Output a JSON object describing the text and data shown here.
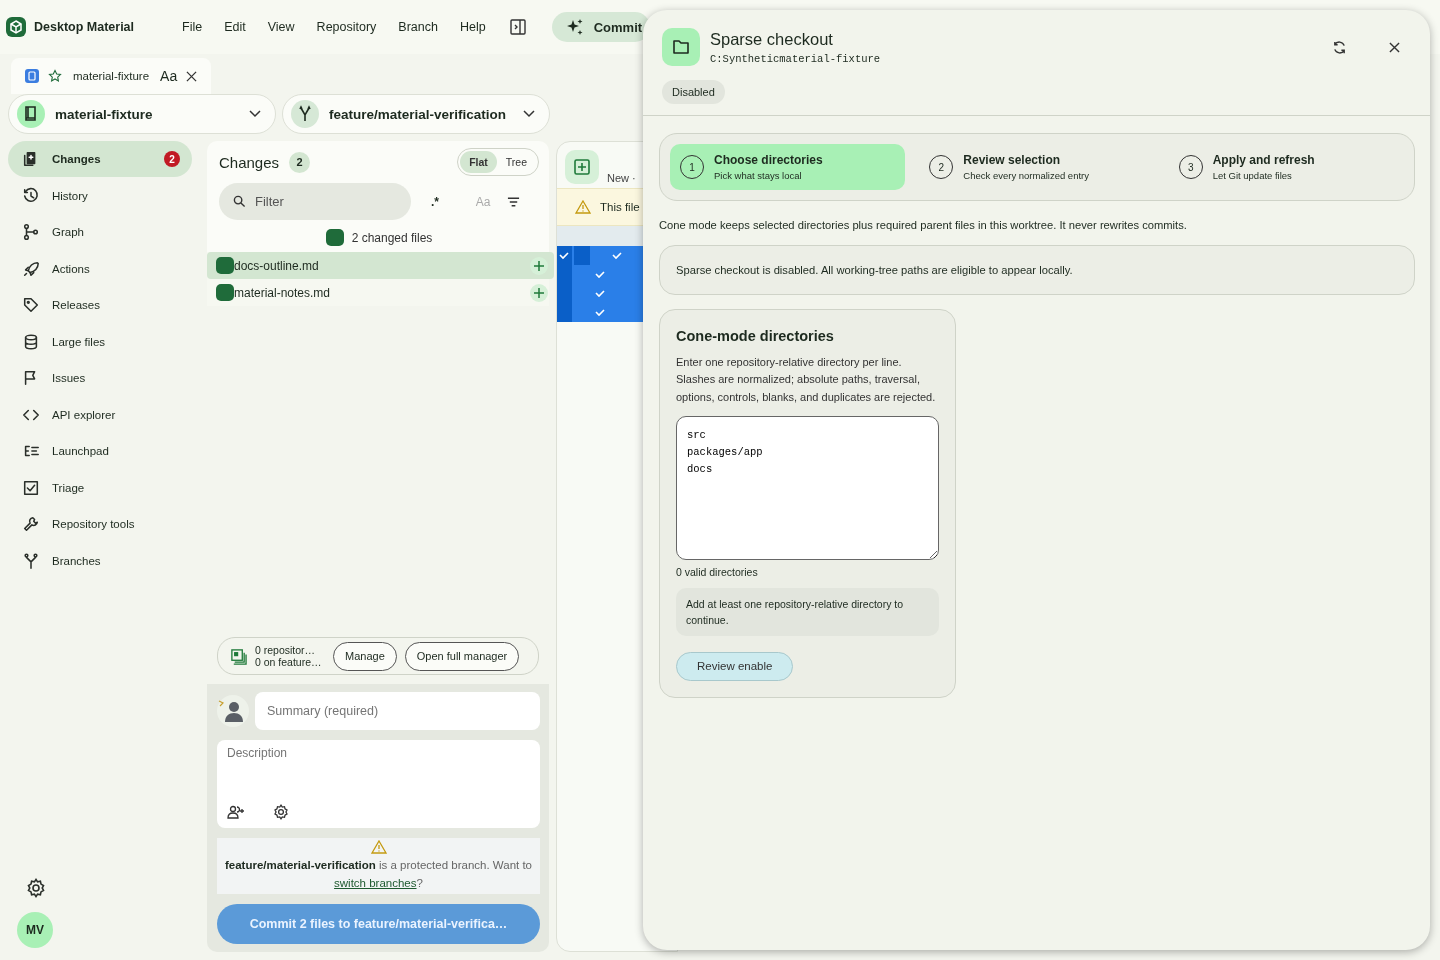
{
  "app": {
    "title": "Desktop Material",
    "menu": [
      "File",
      "Edit",
      "View",
      "Repository",
      "Branch",
      "Help"
    ],
    "commit_button": "Commit"
  },
  "repo_tab": {
    "name": "material-fixture",
    "font_toggle": "Aa"
  },
  "repository_selector": {
    "label": "material-fixture"
  },
  "branch_selector": {
    "label": "feature/material-verification"
  },
  "sidebar": {
    "items": [
      {
        "label": "Changes",
        "badge": "2",
        "selected": true
      },
      {
        "label": "History",
        "selected": false
      },
      {
        "label": "Graph",
        "selected": false
      },
      {
        "label": "Actions",
        "selected": false
      },
      {
        "label": "Releases",
        "selected": false
      },
      {
        "label": "Large files",
        "selected": false
      },
      {
        "label": "Issues",
        "selected": false
      },
      {
        "label": "API explorer",
        "selected": false
      },
      {
        "label": "Launchpad",
        "selected": false
      },
      {
        "label": "Triage",
        "selected": false
      },
      {
        "label": "Repository tools",
        "selected": false
      },
      {
        "label": "Branches",
        "selected": false
      }
    ],
    "user_initials": "MV"
  },
  "changes": {
    "title": "Changes",
    "count": "2",
    "view_modes": [
      {
        "label": "Flat",
        "selected": true
      },
      {
        "label": "Tree",
        "selected": false
      }
    ],
    "filter": {
      "placeholder": "Filter"
    },
    "regex_toggle": ".*",
    "case_toggle": "Aa",
    "summary": "2 changed files",
    "files": [
      {
        "name": "docs-outline.md",
        "selected": true
      },
      {
        "name": "material-notes.md",
        "selected": false
      }
    ]
  },
  "worktree_notice": {
    "line_1": "0 repositor…",
    "line_2": "0 on feature…",
    "buttons": [
      "Manage",
      "Open full manager"
    ]
  },
  "commit_form": {
    "summary": {
      "placeholder": "Summary (required)"
    },
    "description": {
      "placeholder": "Description"
    },
    "warning": "**feature/material-verification** is a protected branch. Want to",
    "warning_link": "switch branches",
    "warning_end": "?",
    "commit_button": "Commit 2 files to feature/material-verifica…"
  },
  "diff_panel": {
    "header": "New ·",
    "banner": "This file"
  },
  "sparse_dialog": {
    "title": "Sparse checkout",
    "path": "C:Syntheticmaterial-fixture",
    "status": "Disabled",
    "steps": [
      {
        "number": "1",
        "title": "Choose directories",
        "subtitle": "Pick what stays local",
        "selected": true
      },
      {
        "number": "2",
        "title": "Review selection",
        "subtitle": "Check every normalized entry",
        "selected": false
      },
      {
        "number": "3",
        "title": "Apply and refresh",
        "subtitle": "Let Git update files",
        "selected": false
      }
    ],
    "intro": "Cone mode keeps selected directories plus required parent files in this worktree. It never rewrites commits.",
    "status_message": "Sparse checkout is disabled. All working-tree paths are eligible to appear locally.",
    "directories_card": {
      "title": "Cone-mode directories",
      "help": "Enter one repository-relative directory per line. Slashes are normalized; absolute paths, traversal, options, controls, blanks, and duplicates are rejected.",
      "value": "src\npackages/app\ndocs",
      "count": "0 valid directories",
      "hint": "Add at least one repository-relative directory to continue.",
      "button": "Review enable"
    }
  }
}
